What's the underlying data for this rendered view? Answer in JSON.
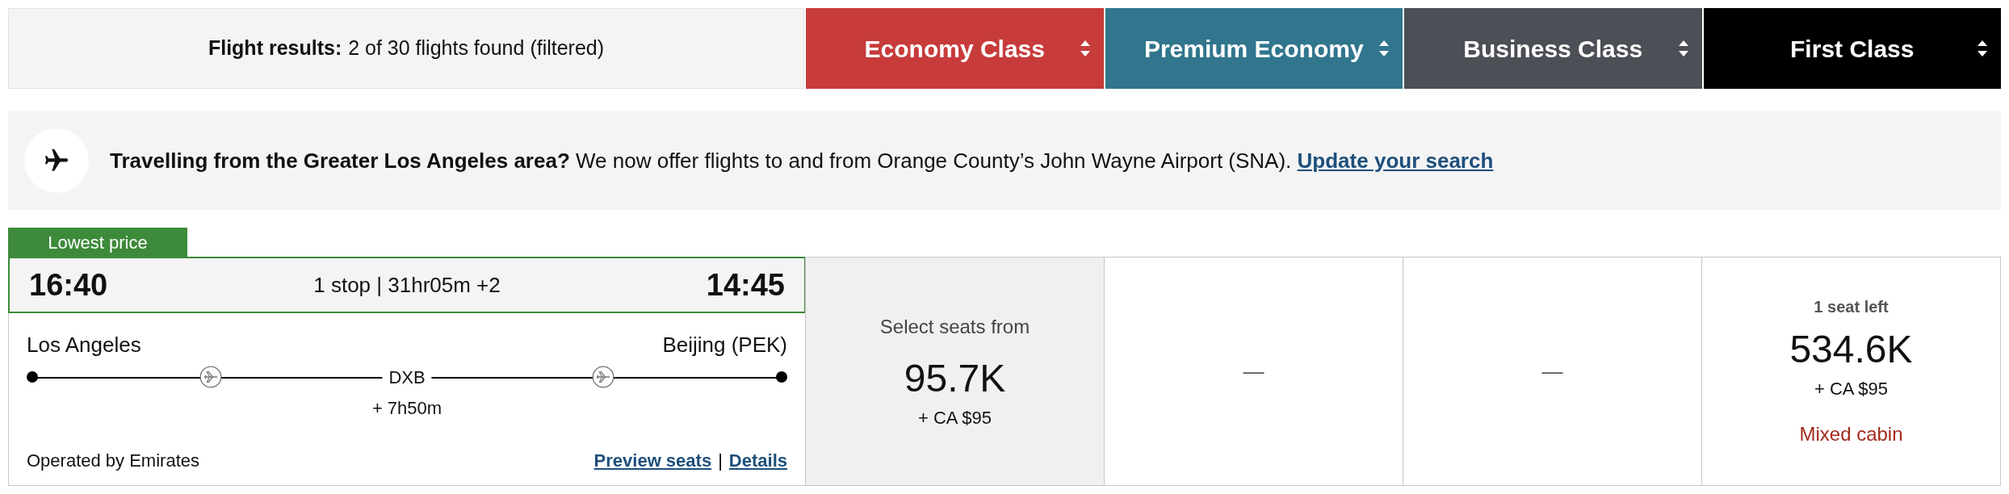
{
  "results_summary": {
    "label": "Flight results:",
    "text": "2 of 30 flights found (filtered)"
  },
  "cabin_columns": [
    {
      "label": "Economy Class",
      "color": "#c73b3b"
    },
    {
      "label": "Premium Economy",
      "color": "#31768d"
    },
    {
      "label": "Business Class",
      "color": "#4c4f55"
    },
    {
      "label": "First Class",
      "color": "#000000"
    }
  ],
  "notice": {
    "text": "**Travelling from the Greater Los Angeles area?** We now offer flights to and from Orange County’s John Wayne Airport (SNA).",
    "link": "Update your search"
  },
  "flight": {
    "badge": "Lowest price",
    "depart_time": "16:40",
    "summary": "1 stop | 31hr05m +2",
    "arrive_time": "14:45",
    "origin": "Los Angeles",
    "destination": "Beijing (PEK)",
    "stop": "DXB",
    "layover": "+ 7h50m",
    "operator": "Operated by Emirates",
    "links": [
      "Preview seats",
      "Details"
    ],
    "link_separator": "|",
    "fares": [
      {
        "kind": "price",
        "selected": true,
        "caption": "Select seats from",
        "price": "95.7K",
        "fee": "+ CA $95"
      },
      {
        "kind": "none",
        "selected": false,
        "text": "—"
      },
      {
        "kind": "none",
        "selected": false,
        "text": "—"
      },
      {
        "kind": "price",
        "selected": false,
        "availability": "1 seat left",
        "price": "534.6K",
        "fee": "+ CA $95",
        "note": "Mixed cabin"
      }
    ]
  }
}
